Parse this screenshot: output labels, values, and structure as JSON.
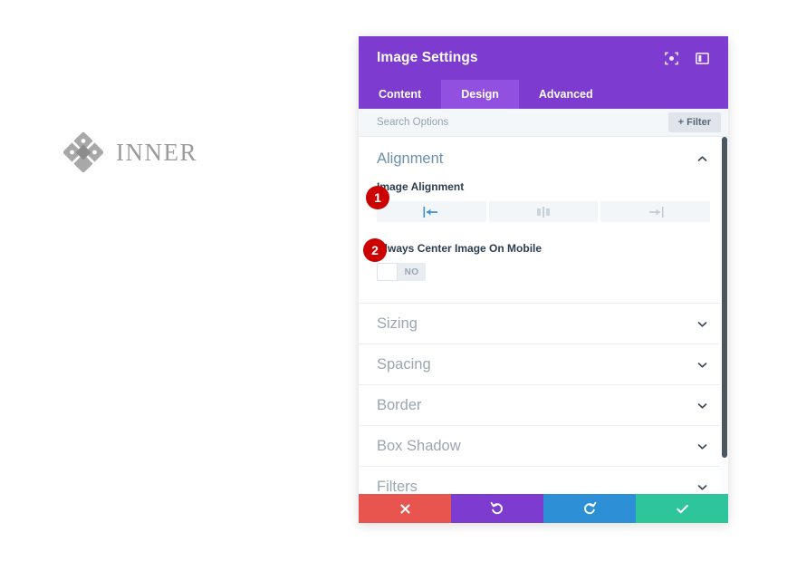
{
  "page": {
    "background_color": "#ffffff"
  },
  "logo": {
    "name": "INNER",
    "mark_icon": "diamond-cluster-icon",
    "color": "#9b9b9b"
  },
  "panel": {
    "title": "Image Settings",
    "header_color": "#7e3bd0",
    "header_icons": [
      {
        "name": "focus-target-icon",
        "label": "Focus"
      },
      {
        "name": "layout-columns-icon",
        "label": "Layout"
      }
    ],
    "tabs": [
      {
        "label": "Content",
        "active": false
      },
      {
        "label": "Design",
        "active": true
      },
      {
        "label": "Advanced",
        "active": false
      }
    ],
    "active_tab_color": "#9250e0",
    "search": {
      "placeholder": "Search Options",
      "value": ""
    },
    "filter_button": {
      "label": "+ Filter"
    },
    "sections": [
      {
        "title": "Alignment",
        "expanded": true,
        "chevron": "chevron-up-icon",
        "fields": [
          {
            "label": "Image Alignment",
            "type": "button-group",
            "options": [
              {
                "name": "align-left-icon",
                "label": "Left",
                "selected": true
              },
              {
                "name": "align-center-icon",
                "label": "Center",
                "selected": false
              },
              {
                "name": "align-right-icon",
                "label": "Right",
                "selected": false
              }
            ]
          },
          {
            "label": "Always Center Image On Mobile",
            "type": "toggle",
            "value": "NO",
            "on": false
          }
        ]
      },
      {
        "title": "Sizing",
        "expanded": false,
        "chevron": "chevron-down-icon"
      },
      {
        "title": "Spacing",
        "expanded": false,
        "chevron": "chevron-down-icon"
      },
      {
        "title": "Border",
        "expanded": false,
        "chevron": "chevron-down-icon"
      },
      {
        "title": "Box Shadow",
        "expanded": false,
        "chevron": "chevron-down-icon"
      },
      {
        "title": "Filters",
        "expanded": false,
        "chevron": "chevron-down-icon"
      }
    ],
    "footer_buttons": [
      {
        "name": "cancel-button",
        "icon": "close-icon",
        "color": "#e8554e",
        "label": "Cancel"
      },
      {
        "name": "undo-button",
        "icon": "undo-icon",
        "color": "#7e3bd0",
        "label": "Undo"
      },
      {
        "name": "redo-button",
        "icon": "redo-icon",
        "color": "#2d8fd5",
        "label": "Redo"
      },
      {
        "name": "save-button",
        "icon": "check-icon",
        "color": "#2fc59a",
        "label": "Save"
      }
    ],
    "scrollbar": {
      "color": "#4a5660"
    }
  },
  "annotations": [
    {
      "number": "1",
      "target": "image-alignment-field",
      "color": "#cc0000"
    },
    {
      "number": "2",
      "target": "always-center-mobile-toggle",
      "color": "#cc0000"
    }
  ]
}
